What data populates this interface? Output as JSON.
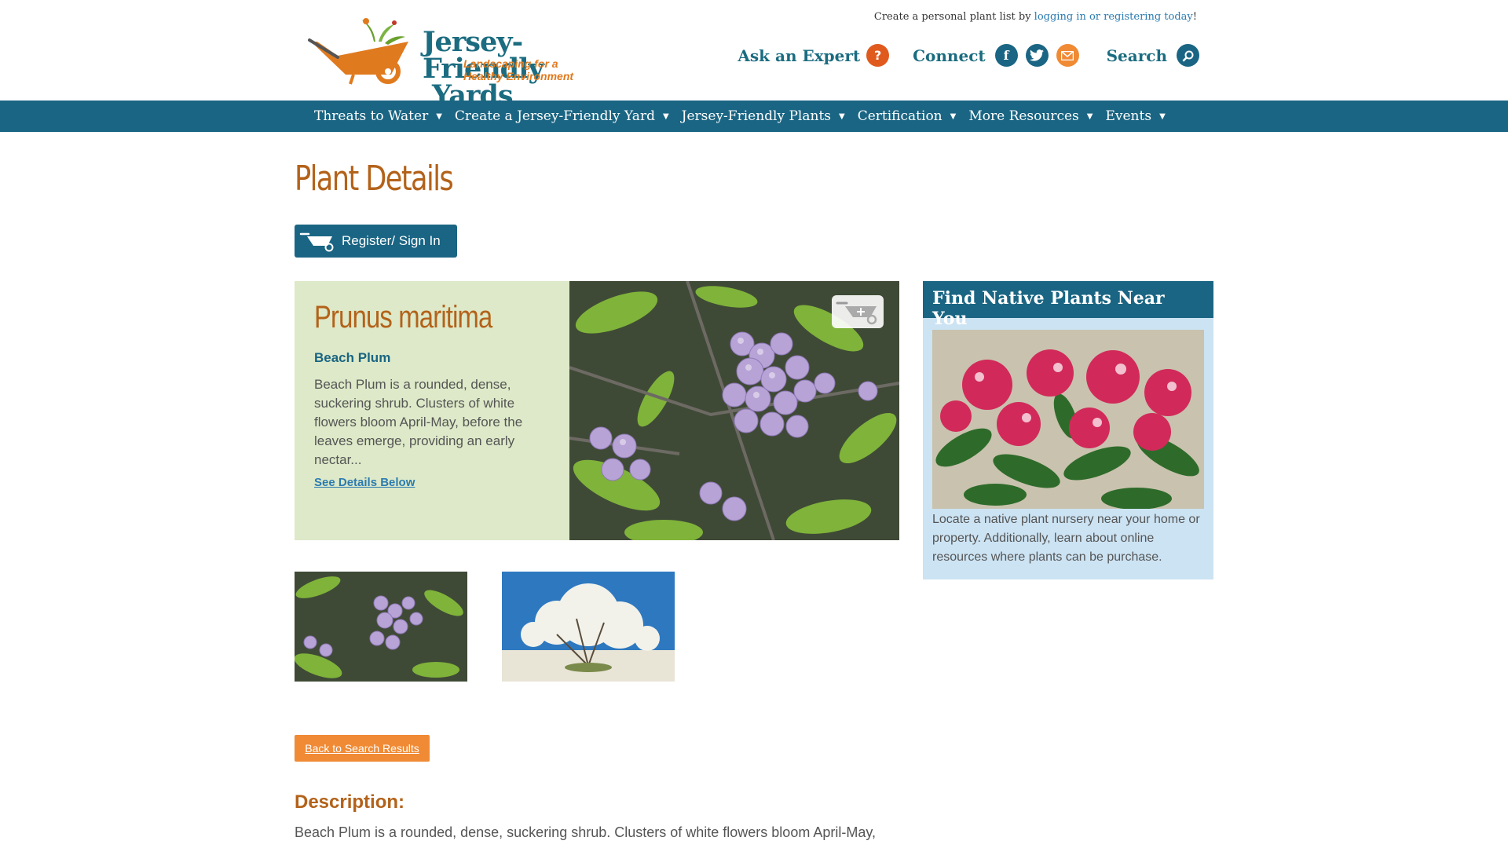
{
  "header": {
    "top_note_prefix": "Create a personal plant list by ",
    "top_note_link": "logging in or registering today",
    "top_note_suffix": "!",
    "logo_title_1": "Jersey-Friendly",
    "logo_title_2": "Yards",
    "logo_tagline_1": "Landscaping for a",
    "logo_tagline_2": "Healthy Environment",
    "ask_expert": "Ask an Expert",
    "ask_expert_icon": "?",
    "connect": "Connect",
    "facebook_icon": "f",
    "search": "Search"
  },
  "nav": {
    "items": [
      {
        "label": "Threats to Water"
      },
      {
        "label": "Create a Jersey-Friendly Yard"
      },
      {
        "label": "Jersey-Friendly Plants"
      },
      {
        "label": "Certification"
      },
      {
        "label": "More Resources"
      },
      {
        "label": "Events"
      }
    ]
  },
  "main": {
    "page_title": "Plant Details",
    "register_label": "Register/ Sign In",
    "plant": {
      "scientific_name": "Prunus maritima",
      "common_name": "Beach Plum",
      "short_description": "Beach Plum is a rounded, dense, suckering shrub. Clusters of white flowers bloom April-May, before the leaves emerge, providing an early nectar...",
      "see_details": "See Details Below"
    },
    "back_label": "Back to Search Results",
    "description_heading": "Description:",
    "description_text": "Beach Plum is a rounded, dense, suckering shrub. Clusters of white flowers bloom April-May,"
  },
  "sidebar": {
    "heading": "Find Native Plants Near You",
    "text": "Locate a native plant nursery near your home or property. Additionally, learn about online resources where plants can be purchase."
  },
  "colors": {
    "primary": "#1a6583",
    "accent_orange": "#b3621a",
    "button_orange": "#f08a34",
    "feature_bg": "#dde9c8",
    "sidebar_bg": "#cce3f3"
  }
}
